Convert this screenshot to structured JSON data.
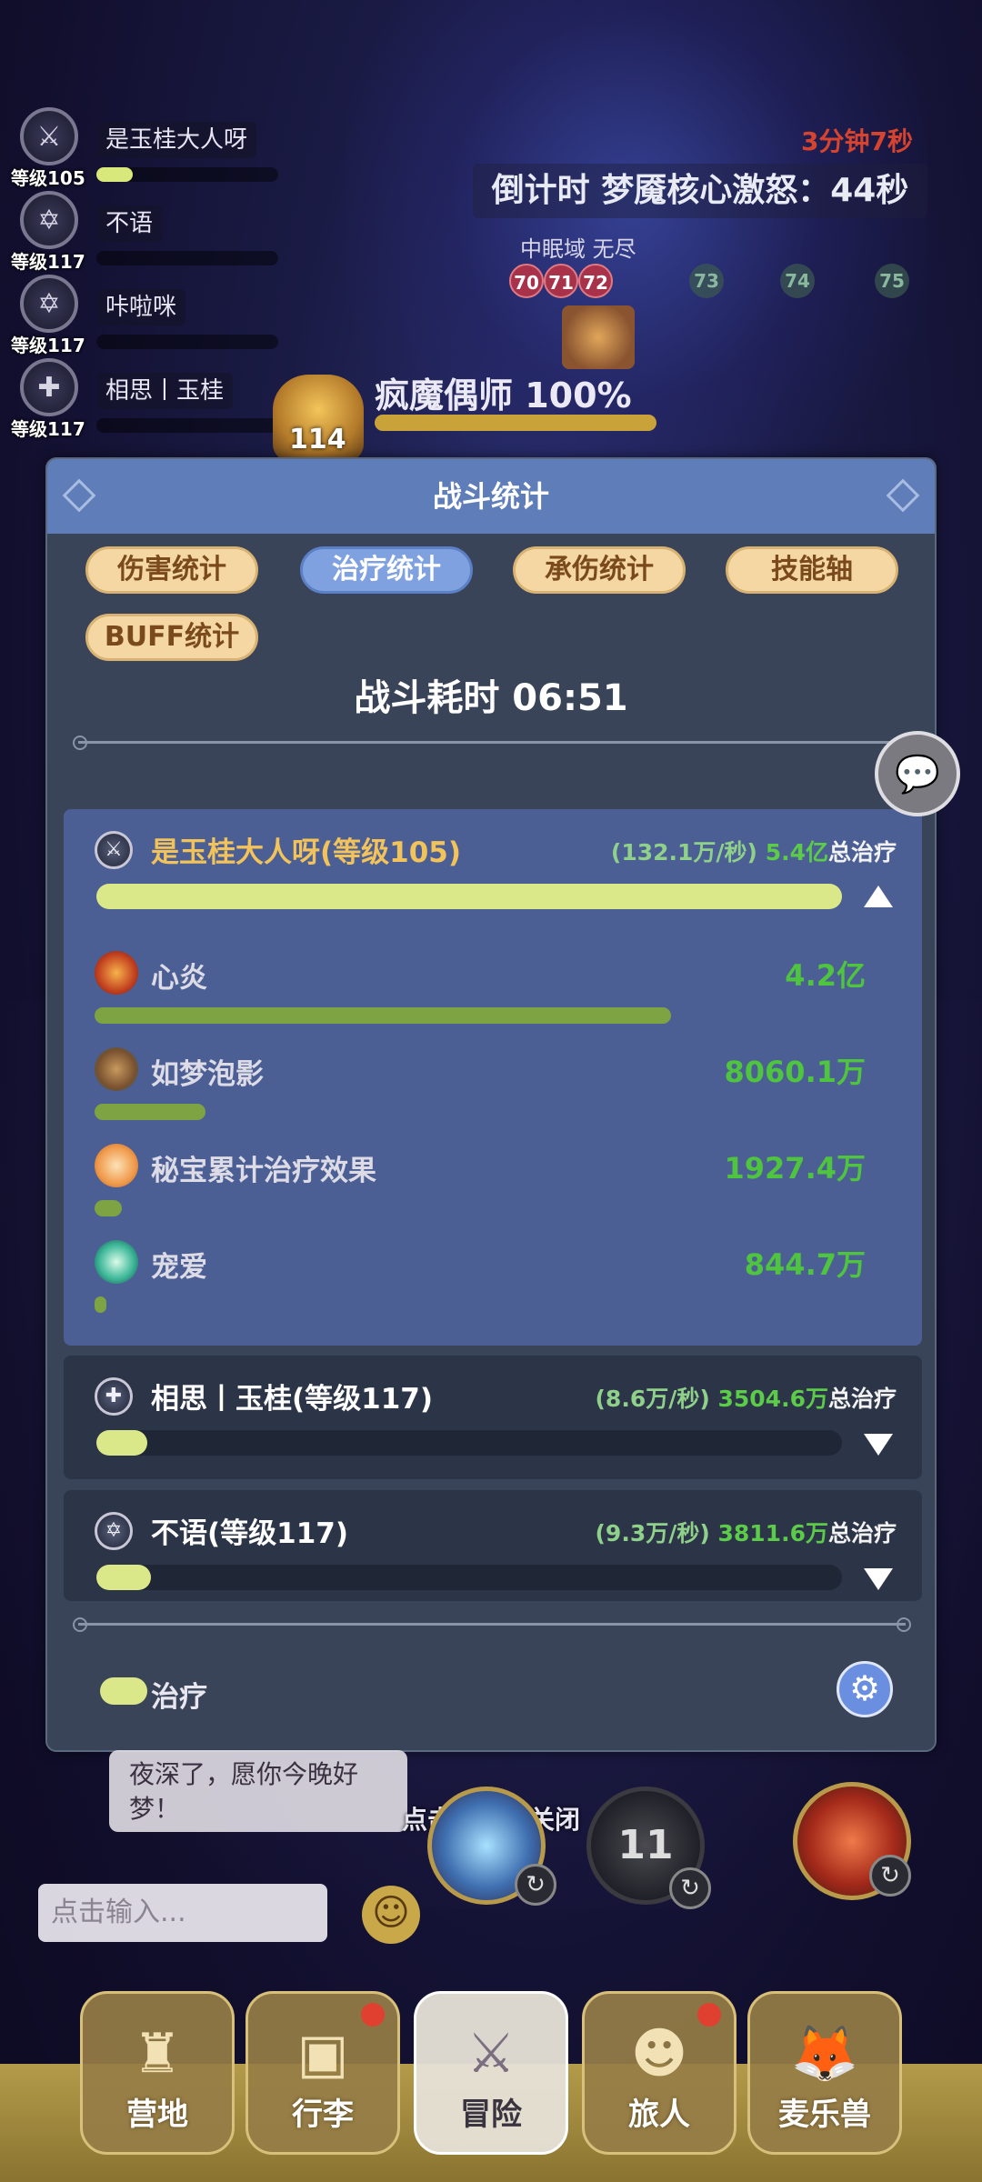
{
  "team": [
    {
      "name": "是玉桂大人呀",
      "level": "等级105",
      "icon": "sword-class-icon",
      "hp": 0.2
    },
    {
      "name": "不语",
      "level": "等级117",
      "icon": "star-class-icon",
      "hp": 0
    },
    {
      "name": "咔啦咪",
      "level": "等级117",
      "icon": "star-class-icon",
      "hp": 0
    },
    {
      "name": "相思丨玉桂",
      "level": "等级117",
      "icon": "cross-class-icon",
      "hp": 0
    }
  ],
  "hud": {
    "battle_timer": "3分钟7秒",
    "countdown": "倒计时 梦魇核心激怒：44秒",
    "zone": "中眠域  无尽",
    "waves_active": [
      "70",
      "71",
      "72"
    ],
    "waves_next": [
      "73",
      "74",
      "75"
    ],
    "boss_level": "114",
    "boss_name": "疯魔偶师 100%"
  },
  "modal": {
    "title": "战斗统计",
    "tabs": [
      {
        "label": "伤害统计",
        "active": false
      },
      {
        "label": "治疗统计",
        "active": true
      },
      {
        "label": "承伤统计",
        "active": false
      },
      {
        "label": "技能轴",
        "active": false
      },
      {
        "label": "BUFF统计",
        "active": false
      }
    ],
    "duration": "战斗耗时  06:51",
    "players": [
      {
        "name": "是玉桂大人呀(等级105)",
        "rate": "(132.1万/秒)",
        "total": "5.4亿",
        "total_suffix": "总治疗",
        "expanded": true,
        "share": 0.95,
        "skills": [
          {
            "name": "心炎",
            "value": "4.2亿",
            "share": 0.78,
            "icon": "fire-heart-icon"
          },
          {
            "name": "如梦泡影",
            "value": "8060.1万",
            "share": 0.15,
            "icon": "capybara-icon"
          },
          {
            "name": "秘宝累计治疗效果",
            "value": "1927.4万",
            "share": 0.036,
            "icon": "treasure-face-icon"
          },
          {
            "name": "宠爱",
            "value": "844.7万",
            "share": 0.016,
            "icon": "green-leaf-icon"
          }
        ]
      },
      {
        "name": "相思丨玉桂(等级117)",
        "rate": "(8.6万/秒)",
        "total": "3504.6万",
        "total_suffix": "总治疗",
        "expanded": false,
        "share": 0.065
      },
      {
        "name": "不语(等级117)",
        "rate": "(9.3万/秒)",
        "total": "3811.6万",
        "total_suffix": "总治疗",
        "expanded": false,
        "share": 0.07
      }
    ],
    "legend": "治疗",
    "close_hint": "点击空白处关闭"
  },
  "chat": {
    "message": "夜深了，愿你今晚好梦！",
    "input_placeholder": "点击输入..."
  },
  "skill_orbs": [
    {
      "label": "",
      "icon": "ice-spirit-icon"
    },
    {
      "label": "11",
      "icon": "cooldown-orb-icon"
    },
    {
      "label": "",
      "icon": "flame-burst-icon"
    }
  ],
  "nav": [
    {
      "label": "营地",
      "icon": "castle-icon",
      "badge": false,
      "active": false
    },
    {
      "label": "行李",
      "icon": "chest-icon",
      "badge": true,
      "active": false
    },
    {
      "label": "冒险",
      "icon": "crossed-swords-icon",
      "badge": false,
      "active": true
    },
    {
      "label": "旅人",
      "icon": "traveler-icon",
      "badge": true,
      "active": false
    },
    {
      "label": "麦乐兽",
      "icon": "fox-icon",
      "badge": false,
      "active": false
    }
  ],
  "colors": {
    "modal_bg": "#3a4458",
    "header_bg": "#5f7eb9",
    "tab_active": "#7fa1df",
    "tab_inactive": "#f4d7a2",
    "heal_bar": "#dbe88a",
    "skill_bar": "#7ea342",
    "value_green": "#4fc43e",
    "name_gold": "#f2c35a"
  }
}
